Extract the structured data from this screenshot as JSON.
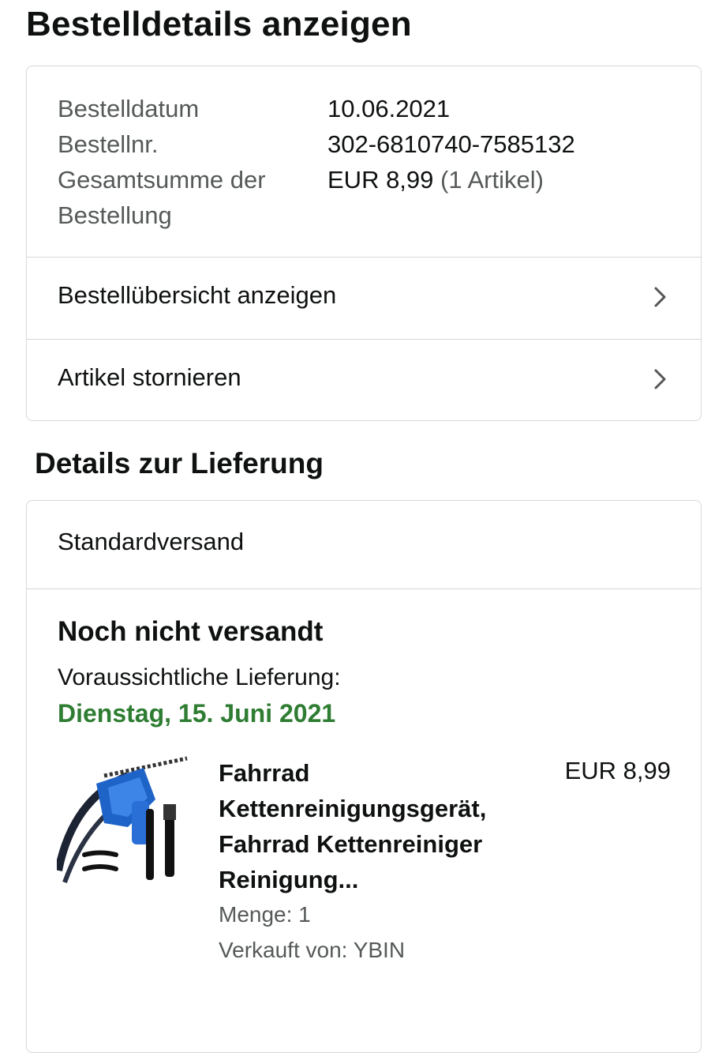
{
  "page": {
    "title": "Bestelldetails anzeigen"
  },
  "summary": {
    "date_label": "Bestelldatum",
    "date_value": "10.06.2021",
    "order_no_label": "Bestellnr.",
    "order_no_value": "302-6810740-7585132",
    "total_label": "Gesamtsumme der Bestellung",
    "total_value": "EUR 8,99",
    "total_items": "(1 Artikel)"
  },
  "actions": [
    {
      "label": "Bestellübersicht anzeigen",
      "icon": "chevron-right-icon"
    },
    {
      "label": "Artikel stornieren",
      "icon": "chevron-right-icon"
    }
  ],
  "delivery": {
    "section_title": "Details zur Lieferung",
    "shipping_method": "Standardversand",
    "status": "Noch nicht versandt",
    "estimate_label": "Voraussichtliche Lieferung:",
    "estimate_date": "Dienstag, 15. Juni 2021",
    "estimate_color": "#2e7d32",
    "item": {
      "name": "Fahrrad Kettenreinigungsgerät, Fahrrad Kettenreiniger Reinigung...",
      "price": "EUR 8,99",
      "quantity": "Menge: 1",
      "seller": "Verkauft von: YBIN",
      "image": "bicycle-chain-cleaner-product-image"
    }
  },
  "colors": {
    "border": "#d5d9d9",
    "muted_text": "#565959",
    "text": "#0f1111"
  }
}
